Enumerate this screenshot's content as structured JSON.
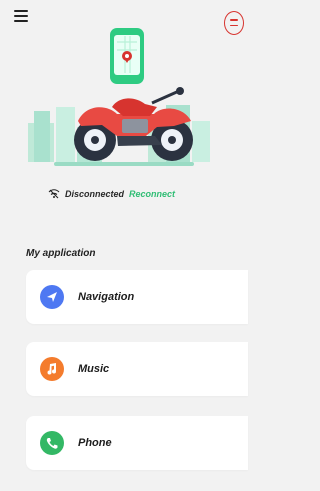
{
  "status": {
    "disconnected_text": "Disconnected",
    "reconnect_text": "Reconnect"
  },
  "section": {
    "title": "My application"
  },
  "apps": [
    {
      "label": "Navigation",
      "icon": "navigation-icon",
      "color": "#4e78f2"
    },
    {
      "label": "Music",
      "icon": "music-icon",
      "color": "#f47c2d"
    },
    {
      "label": "Phone",
      "icon": "phone-icon",
      "color": "#33b865"
    }
  ],
  "colors": {
    "accent_red": "#d7342f",
    "reconnect_green": "#2fbd74"
  }
}
